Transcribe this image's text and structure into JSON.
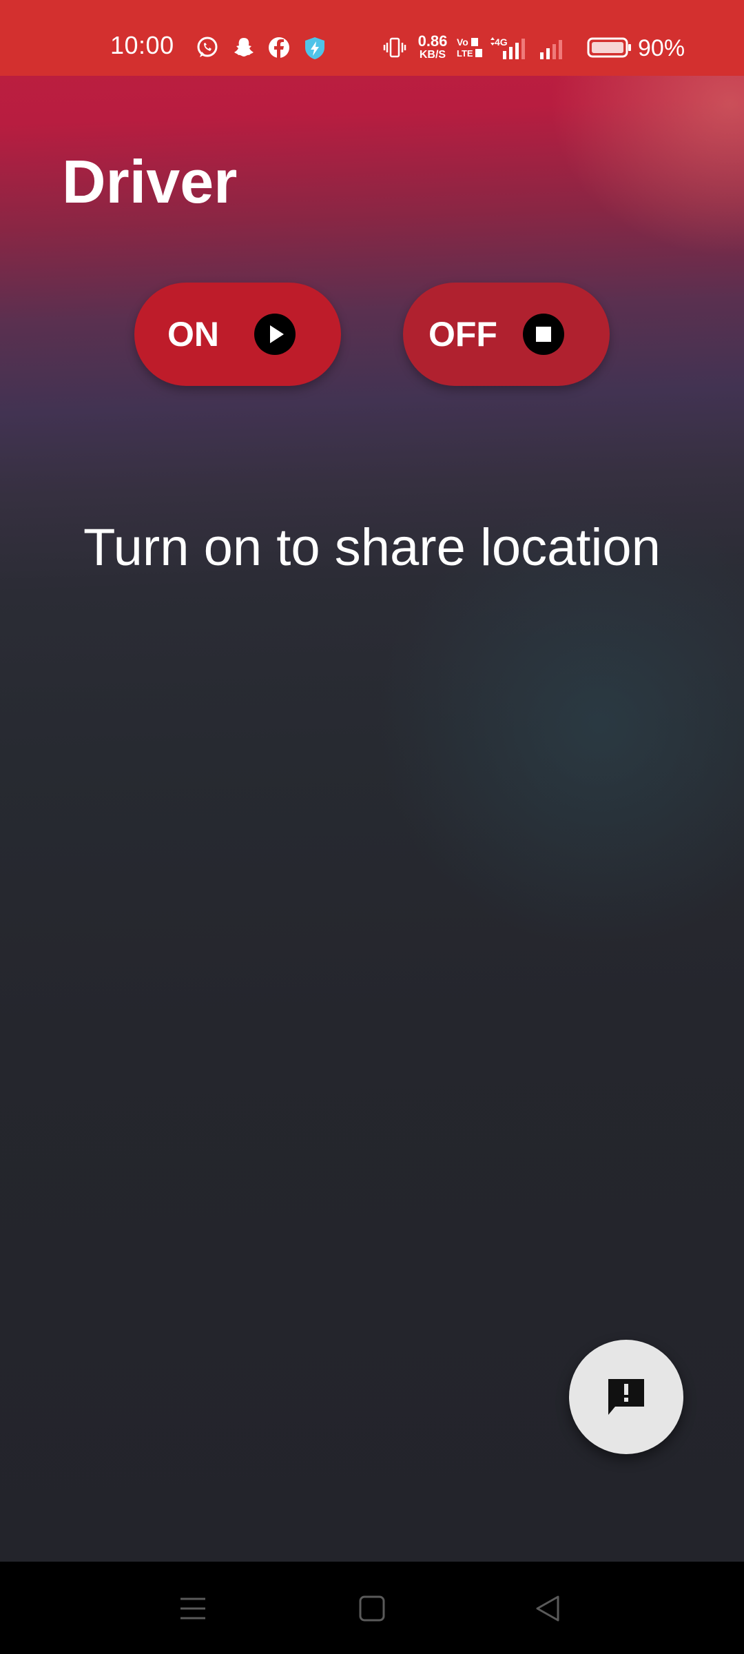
{
  "status_bar": {
    "time": "10:00",
    "net_speed_value": "0.86",
    "net_speed_unit": "KB/S",
    "battery_percent": "90%",
    "icons": [
      "whatsapp-icon",
      "snapchat-icon",
      "facebook-icon",
      "shield-bolt-icon",
      "vibrate-icon",
      "volte-icon",
      "signal-4g-icon",
      "signal-icon",
      "battery-icon"
    ]
  },
  "page": {
    "title": "Driver"
  },
  "controls": {
    "on_label": "ON",
    "off_label": "OFF",
    "on_icon": "play-icon",
    "off_icon": "stop-icon"
  },
  "message": "Turn on to share location",
  "fab": {
    "icon": "feedback-icon"
  },
  "nav_bar": {
    "icons": [
      "menu-icon",
      "home-icon",
      "back-icon"
    ]
  },
  "colors": {
    "status_bar": "#d3302f",
    "button": "#b61f2c",
    "fab": "#e6e6e6",
    "background_dark": "#24252c"
  }
}
